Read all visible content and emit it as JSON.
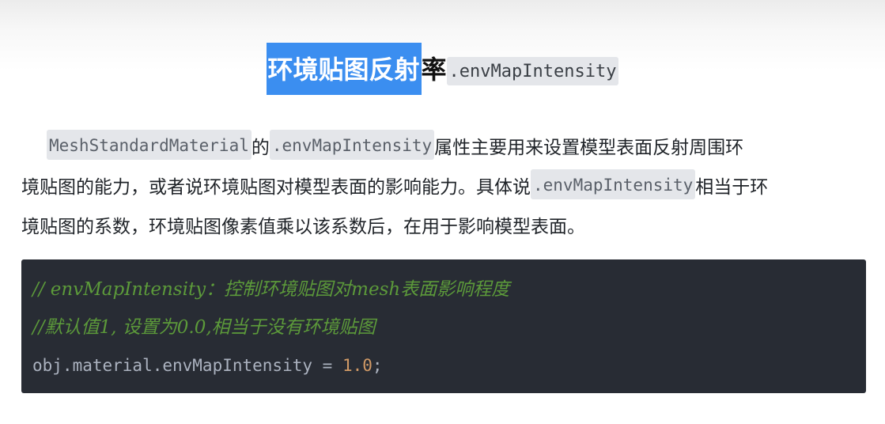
{
  "heading": {
    "selected_text": "环境贴图反射",
    "rest_text": "率",
    "code": ".envMapIntensity"
  },
  "paragraph": {
    "line1": {
      "code1": "MeshStandardMaterial",
      "text1": "的",
      "code2": ".envMapIntensity",
      "text2": "属性主要用来设置模型表面反射周围环"
    },
    "line2": {
      "text1": "境贴图的能力，或者说环境贴图对模型表面的影响能力。具体说",
      "code1": ".envMapIntensity",
      "text2": "相当于环"
    },
    "line3": {
      "text1": "境贴图的系数，环境贴图像素值乘以该系数后，在用于影响模型表面。"
    }
  },
  "code_block": {
    "comment1": "// envMapIntensity：控制环境贴图对mesh表面影响程度",
    "comment2": "//默认值1, 设置为0.0,相当于没有环境贴图",
    "statement": "obj.material.envMapIntensity = ",
    "number": "1.0",
    "terminator": ";"
  },
  "colors": {
    "selection": "#3b8ef0",
    "inline_code_bg": "#e4e6ea",
    "code_bg": "#282c34",
    "comment": "#5c9a3a",
    "number": "#d19a66",
    "plain_code": "#abb2bf"
  }
}
